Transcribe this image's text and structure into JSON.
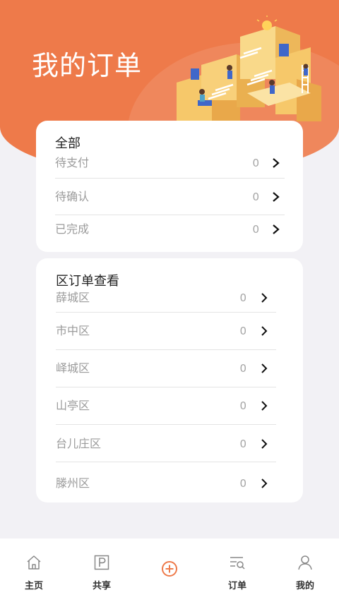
{
  "header": {
    "title": "我的订单"
  },
  "orders_card": {
    "title": "全部",
    "rows": [
      {
        "label": "待支付",
        "count": "0"
      },
      {
        "label": "待确认",
        "count": "0"
      },
      {
        "label": "已完成",
        "count": "0"
      }
    ]
  },
  "district_card": {
    "title": "区订单查看",
    "rows": [
      {
        "label": "薛城区",
        "count": "0"
      },
      {
        "label": "市中区",
        "count": "0"
      },
      {
        "label": "峄城区",
        "count": "0"
      },
      {
        "label": "山亭区",
        "count": "0"
      },
      {
        "label": "台儿庄区",
        "count": "0"
      },
      {
        "label": "滕州区",
        "count": "0"
      }
    ]
  },
  "tabbar": {
    "items": [
      {
        "label": "主页",
        "icon": "home-icon"
      },
      {
        "label": "共享",
        "icon": "parking-icon"
      },
      {
        "label": "",
        "icon": "add-circle-icon"
      },
      {
        "label": "订单",
        "icon": "order-list-icon"
      },
      {
        "label": "我的",
        "icon": "user-icon"
      }
    ]
  },
  "colors": {
    "accent": "#ee7a4a",
    "background": "#f2f1f5"
  }
}
